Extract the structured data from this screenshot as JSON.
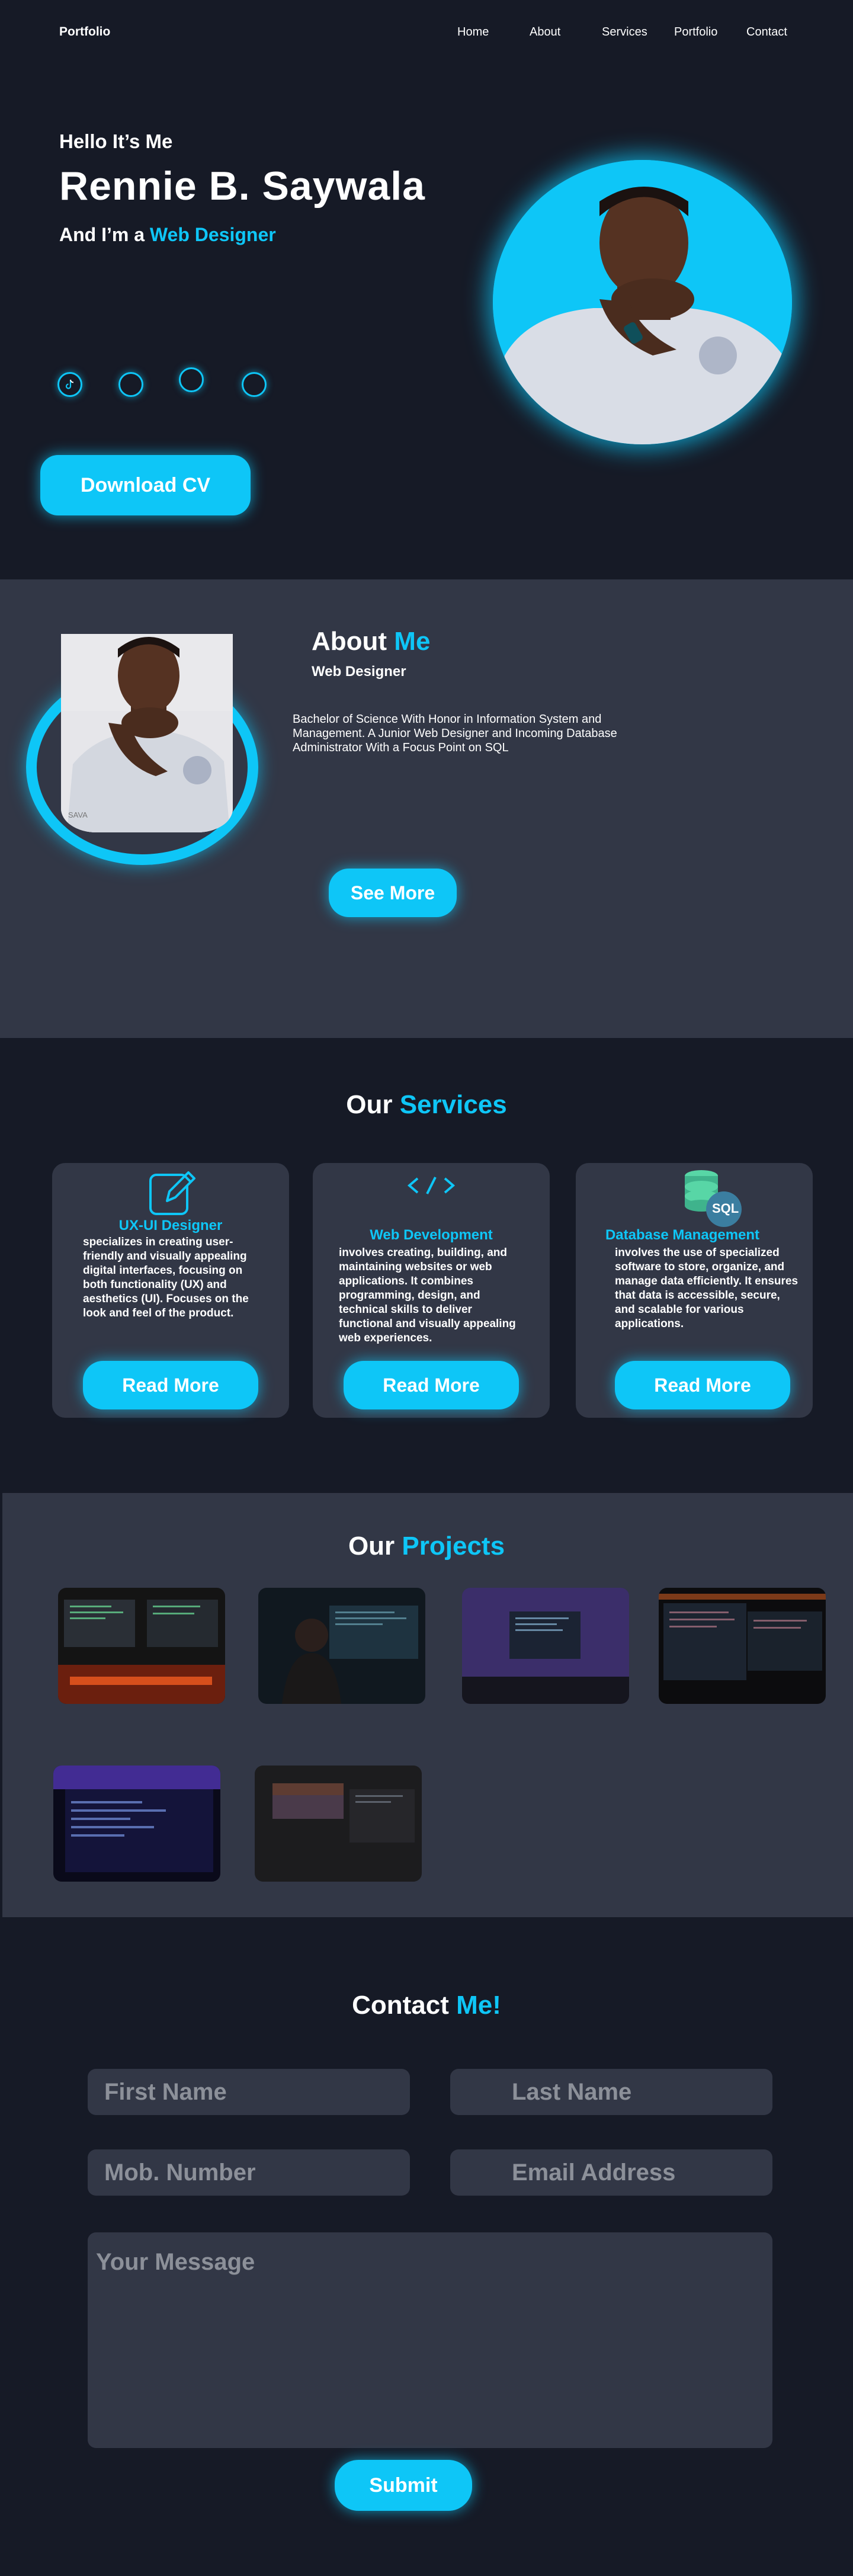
{
  "nav": {
    "logo": "Portfolio",
    "links": [
      "Home",
      "About",
      "Services",
      "Portfolio",
      "Contact"
    ]
  },
  "hero": {
    "greeting": "Hello It’s Me",
    "name": "Rennie B. Saywala",
    "role_prefix": "And I’m a ",
    "role_highlight": "Web Designer",
    "cv_button": "Download CV",
    "social_icons": [
      "tiktok-icon",
      "facebook-icon",
      "github-icon",
      "instagram-icon"
    ]
  },
  "about": {
    "title_prefix": "About ",
    "title_highlight": "Me",
    "subtitle": "Web Designer",
    "text": "Bachelor of Science With Honor in Information System and Management. A Junior Web Designer and Incoming Database Administrator With a Focus Point on SQL",
    "button": "See More",
    "photo_caption": "SAVA"
  },
  "services": {
    "title_prefix": "Our ",
    "title_highlight": "Services",
    "cards": [
      {
        "icon": "pencil-icon",
        "title": "UX-UI Designer",
        "text": "specializes in creating user-friendly and visually appealing digital interfaces, focusing on both functionality (UX) and aesthetics (UI). Focuses on the look and feel of the product.",
        "button": "Read More"
      },
      {
        "icon": "code-icon",
        "title": "Web Development",
        "text": "involves creating, building, and maintaining websites or web applications. It combines programming, design, and technical skills to deliver functional and visually appealing web experiences.",
        "button": "Read More"
      },
      {
        "icon": "database-sql-icon",
        "icon_text": "SQL",
        "title": "Database Management",
        "text": "involves the use of specialized software to store, organize, and manage data efficiently. It ensures that data is accessible, secure, and scalable for various applications.",
        "button": "Read More"
      }
    ]
  },
  "projects": {
    "title_prefix": "Our ",
    "title_highlight": "Projects",
    "count": 6
  },
  "contact": {
    "title_prefix": "Contact ",
    "title_highlight": "Me!",
    "first_name_placeholder": "First Name",
    "last_name_placeholder": "Last Name",
    "phone_placeholder": "Mob. Number",
    "email_placeholder": "Email Address",
    "message_placeholder": "Your Message",
    "submit": "Submit"
  },
  "colors": {
    "background": "#161a26",
    "section_alt": "#323746",
    "accent": "#0ec6f7"
  }
}
